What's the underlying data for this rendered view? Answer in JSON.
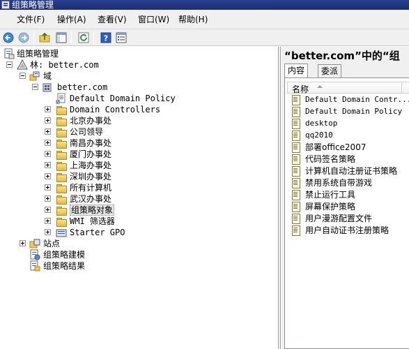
{
  "window": {
    "title": "组策略管理"
  },
  "menu": [
    {
      "label": "文件(F)"
    },
    {
      "label": "操作(A)"
    },
    {
      "label": "查看(V)"
    },
    {
      "label": "窗口(W)"
    },
    {
      "label": "帮助(H)"
    }
  ],
  "toolbar": {
    "buttons": [
      "back-arrow-icon",
      "forward-arrow-icon",
      "up-folder-icon",
      "show-hide-tree-icon",
      "refresh-icon",
      "help-icon",
      "properties-icon"
    ]
  },
  "tree": {
    "root": "组策略管理",
    "forest": "林: better.com",
    "domains": "域",
    "domain": "better.com",
    "domain_children": [
      "Default Domain Policy",
      "Domain Controllers",
      "北京办事处",
      "公司领导",
      "南昌办事处",
      "厦门办事处",
      "上海办事处",
      "深圳办事处",
      "所有计算机",
      "武汉办事处",
      "组策略对象",
      "WMI 筛选器",
      "Starter GPO"
    ],
    "sites": "站点",
    "modeling": "组策略建模",
    "results": "组策略结果"
  },
  "right": {
    "title": "“better.com”中的“组",
    "tabs": [
      {
        "label": "内容"
      },
      {
        "label": "委派"
      }
    ],
    "column_name": "名称",
    "items": [
      "Default Domain Contr...",
      "Default Domain Policy",
      "desktop",
      "qq2010",
      "部署office2007",
      "代码签名策略",
      "计算机自动注册证书策略",
      "禁用系统自带游戏",
      "禁止运行工具",
      "屏幕保护策略",
      "用户漫游配置文件",
      "用户自动证书注册策略"
    ]
  }
}
